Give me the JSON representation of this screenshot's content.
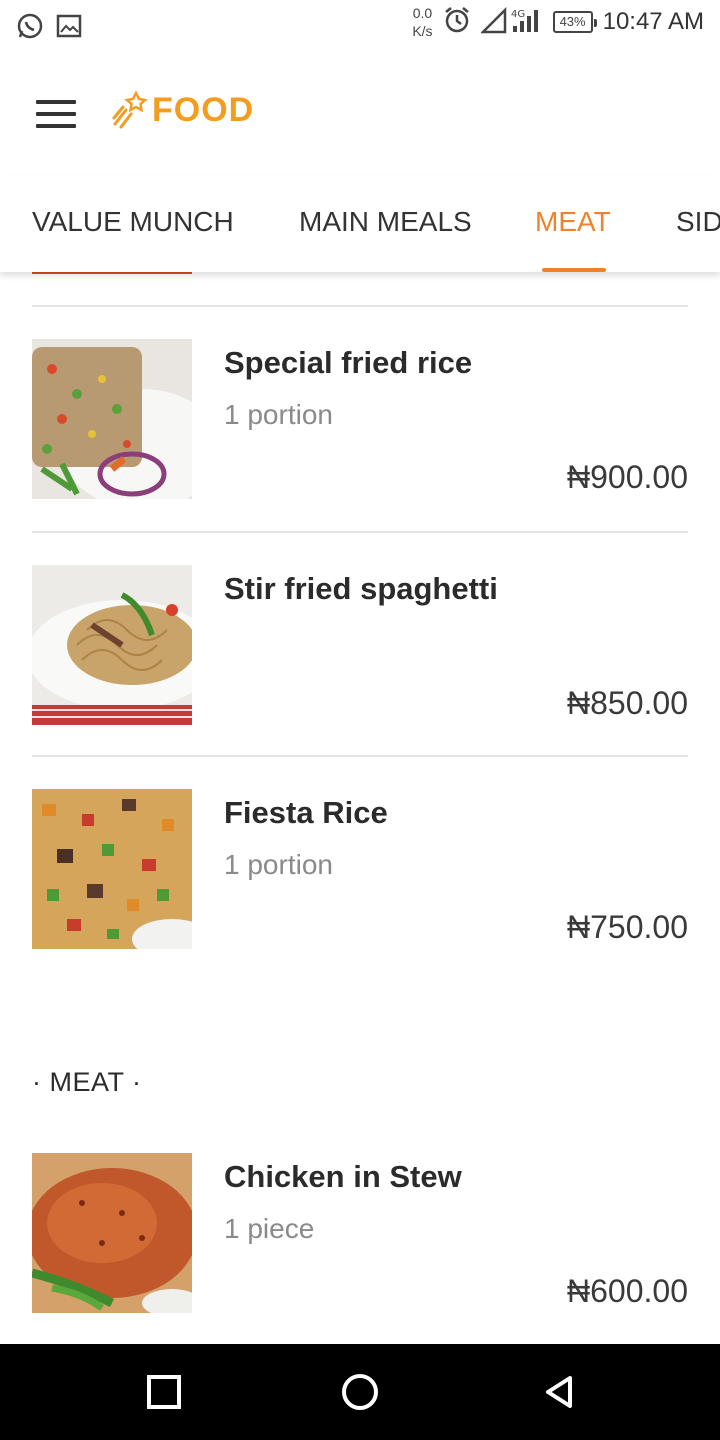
{
  "status_bar": {
    "net_speed_value": "0.0",
    "net_speed_unit": "K/s",
    "network": "4G",
    "battery": "43%",
    "time": "10:47 AM",
    "icons": [
      "whatsapp-icon",
      "gallery-icon",
      "alarm-icon",
      "signal-icon",
      "battery-icon"
    ]
  },
  "app_bar": {
    "logo_text": "FOOD",
    "accent_color": "#f39c1f"
  },
  "tabs": [
    {
      "label": "VALUE MUNCH",
      "active": false
    },
    {
      "label": "MAIN MEALS",
      "active": false
    },
    {
      "label": "MEAT",
      "active": true
    },
    {
      "label": "SIDES",
      "active": false
    }
  ],
  "items": [
    {
      "name": "Special fried rice",
      "portion": "1 portion",
      "price": "₦900.00"
    },
    {
      "name": "Stir fried spaghetti",
      "portion": "",
      "price": "₦850.00"
    },
    {
      "name": "Fiesta Rice",
      "portion": "1 portion",
      "price": "₦750.00"
    }
  ],
  "section": {
    "title": "· MEAT ·",
    "items": [
      {
        "name": "Chicken in Stew",
        "portion": "1 piece",
        "price": "₦600.00"
      }
    ]
  },
  "nav_bar": {
    "icons": [
      "recents-icon",
      "home-icon",
      "back-icon"
    ]
  }
}
